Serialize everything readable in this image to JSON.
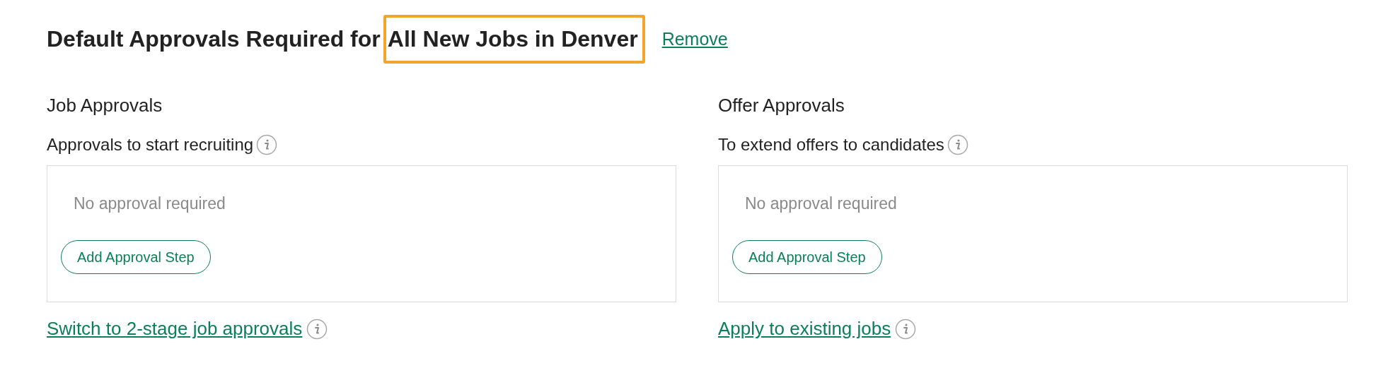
{
  "heading": {
    "text": "Default Approvals Required for",
    "highlight": "All New Jobs in Denver",
    "highlighted": true,
    "action": "Remove"
  },
  "sections": [
    {
      "title": "Job Approvals",
      "subtitle": "Approvals to start recruiting",
      "empty_text": "No approval required",
      "button": "Add Approval Step",
      "link": "Switch to 2-stage job approvals"
    },
    {
      "title": "Offer Approvals",
      "subtitle": "To extend offers to candidates",
      "empty_text": "No approval required",
      "button": "Add Approval Step",
      "link": "Apply to existing jobs"
    }
  ]
}
